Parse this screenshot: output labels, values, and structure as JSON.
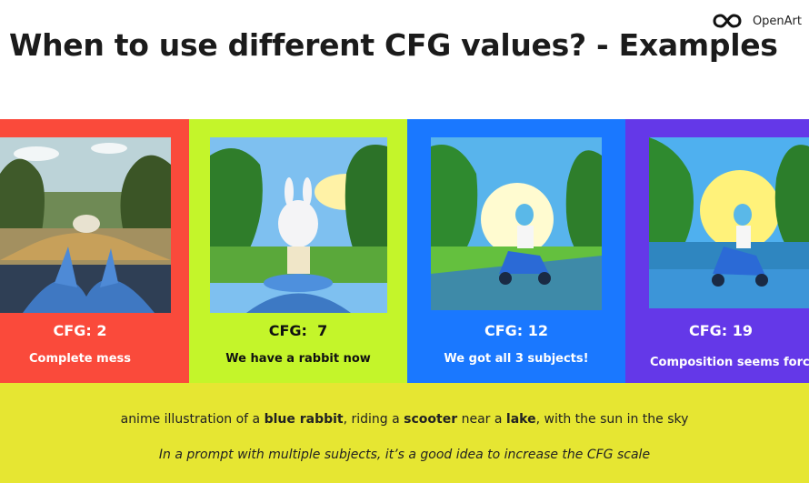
{
  "header": {
    "title": "When to use different CFG values? - Examples",
    "brand": "OpenArt"
  },
  "panels": [
    {
      "cfg": "CFG: 2",
      "description": "Complete mess",
      "bg": "#fa4a3b",
      "text_color": "#ffffff"
    },
    {
      "cfg": "CFG:  7",
      "description": "We have a rabbit now",
      "bg": "#c4f52a",
      "text_color": "#111111"
    },
    {
      "cfg": "CFG: 12",
      "description": "We got all 3 subjects!",
      "bg": "#1a78ff",
      "text_color": "#ffffff"
    },
    {
      "cfg": "CFG: 19",
      "description": "Composition seems force",
      "bg": "#6438e8",
      "text_color": "#ffffff"
    }
  ],
  "prompt": {
    "p1": "anime illustration of a ",
    "b1": "blue rabbit",
    "p2": ", riding a ",
    "b2": "scooter",
    "p3": " near a ",
    "b3": "lake",
    "p4": ", with the sun in the sky"
  },
  "tip": "In a prompt with multiple subjects, it’s a good idea to increase the CFG scale",
  "colors": {
    "bottom_bg": "#e6e632",
    "title": "#1b1b1b"
  }
}
